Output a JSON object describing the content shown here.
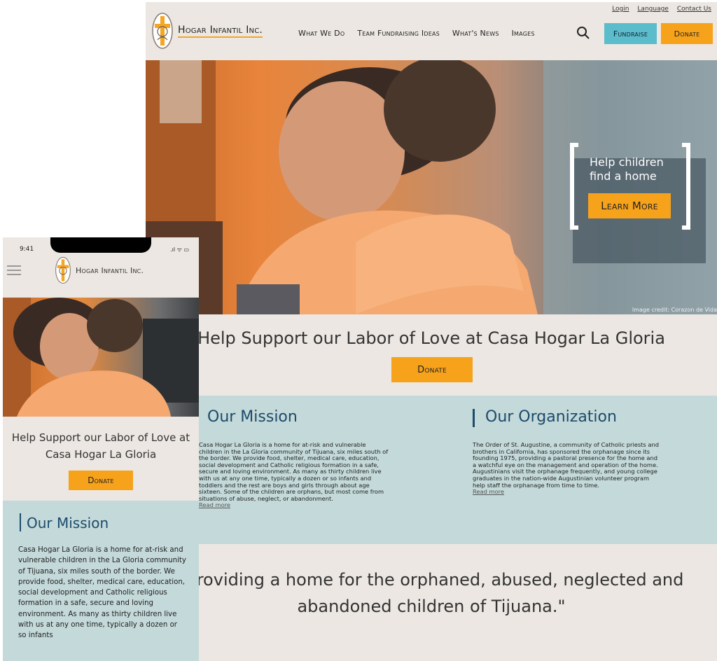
{
  "desktop": {
    "top_links": [
      "Login",
      "Language",
      "Contact Us"
    ],
    "logo_text": "Hogar Infantil Inc.",
    "nav": [
      "What We Do",
      "Team Fundraising Ideas",
      "What's News",
      "Images"
    ],
    "search_icon": "search-icon",
    "fundraise_label": "Fundraise",
    "donate_label": "Donate",
    "hero": {
      "headline": "Help children find a home",
      "cta": "Learn More",
      "credit": "Image credit: Corazon de Vida"
    },
    "support_heading": "Help Support our Labor of Love at Casa Hogar La Gloria",
    "donate_mid_label": "Donate",
    "mission": {
      "title": "Our Mission",
      "body": "Casa Hogar La Gloria is a home for at-risk and vulnerable children in the La Gloria community of Tijuana, six miles south of the border.  We provide food, shelter, medical care, education, social development and Catholic religious formation in a safe, secure and loving environment.  As many as thirty children live with us at any one time, typically a dozen or so infants and toddlers and the rest are boys and girls through about age sixteen.  Some of the children are orphans, but most come from situations of abuse, neglect, or abandonment.",
      "read_more": "Read more"
    },
    "organization": {
      "title": "Our Organization",
      "body": "The Order of St. Augustine, a community of Catholic priests and brothers in California, has sponsored the orphanage since its founding 1975, providing a pastoral presence for the home and a watchful eye on the management and operation of the home.  Augustinians visit the orphanage frequently, and young college graduates in the nation-wide Augustinian volunteer program help staff the orphanage from time to time.",
      "read_more": "Read more"
    },
    "quote": "\"Providing a home for the orphaned, abused, neglected and abandoned children of Tijuana.\""
  },
  "mobile": {
    "status_time": "9:41",
    "status_icons": ".ıl ᯤ ▭",
    "logo_text": "Hogar Infantil Inc.",
    "support_heading": "Help Support our Labor of Love at Casa Hogar La Gloria",
    "donate_label": "Donate",
    "mission_title": "Our Mission",
    "mission_body": "Casa Hogar La Gloria is a home for at-risk and vulnerable children in the La Gloria community of Tijuana, six miles south of the border.  We provide food, shelter, medical care, education, social development and Catholic religious formation in a safe, secure and loving environment.  As many as thirty children live with us at any one time, typically a dozen or so infants"
  },
  "colors": {
    "accent_orange": "#f7a21b",
    "accent_teal": "#5bbccc",
    "band_bg": "#c4d9d9",
    "page_bg": "#ece7e2",
    "heading_blue": "#1c4b6b"
  }
}
